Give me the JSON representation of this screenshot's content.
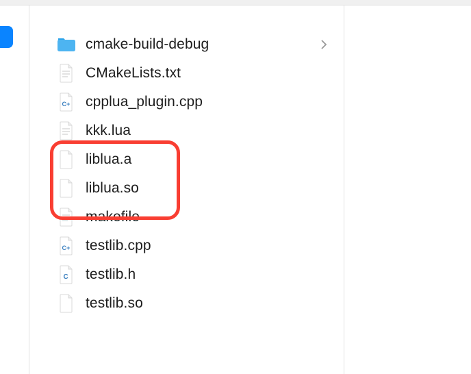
{
  "files": [
    {
      "name": "cmake-build-debug",
      "icon": "folder",
      "has_children": true
    },
    {
      "name": "CMakeLists.txt",
      "icon": "text-file",
      "has_children": false
    },
    {
      "name": "cpplua_plugin.cpp",
      "icon": "cpp-file",
      "has_children": false
    },
    {
      "name": "kkk.lua",
      "icon": "text-file",
      "has_children": false
    },
    {
      "name": "liblua.a",
      "icon": "blank-file",
      "has_children": false
    },
    {
      "name": "liblua.so",
      "icon": "blank-file",
      "has_children": false
    },
    {
      "name": "makefile",
      "icon": "text-file",
      "has_children": false
    },
    {
      "name": "testlib.cpp",
      "icon": "cpp-file",
      "has_children": false
    },
    {
      "name": "testlib.h",
      "icon": "c-file",
      "has_children": false
    },
    {
      "name": "testlib.so",
      "icon": "blank-file",
      "has_children": false
    }
  ],
  "highlight": {
    "indices": [
      4,
      5
    ],
    "color": "#f93e32"
  }
}
